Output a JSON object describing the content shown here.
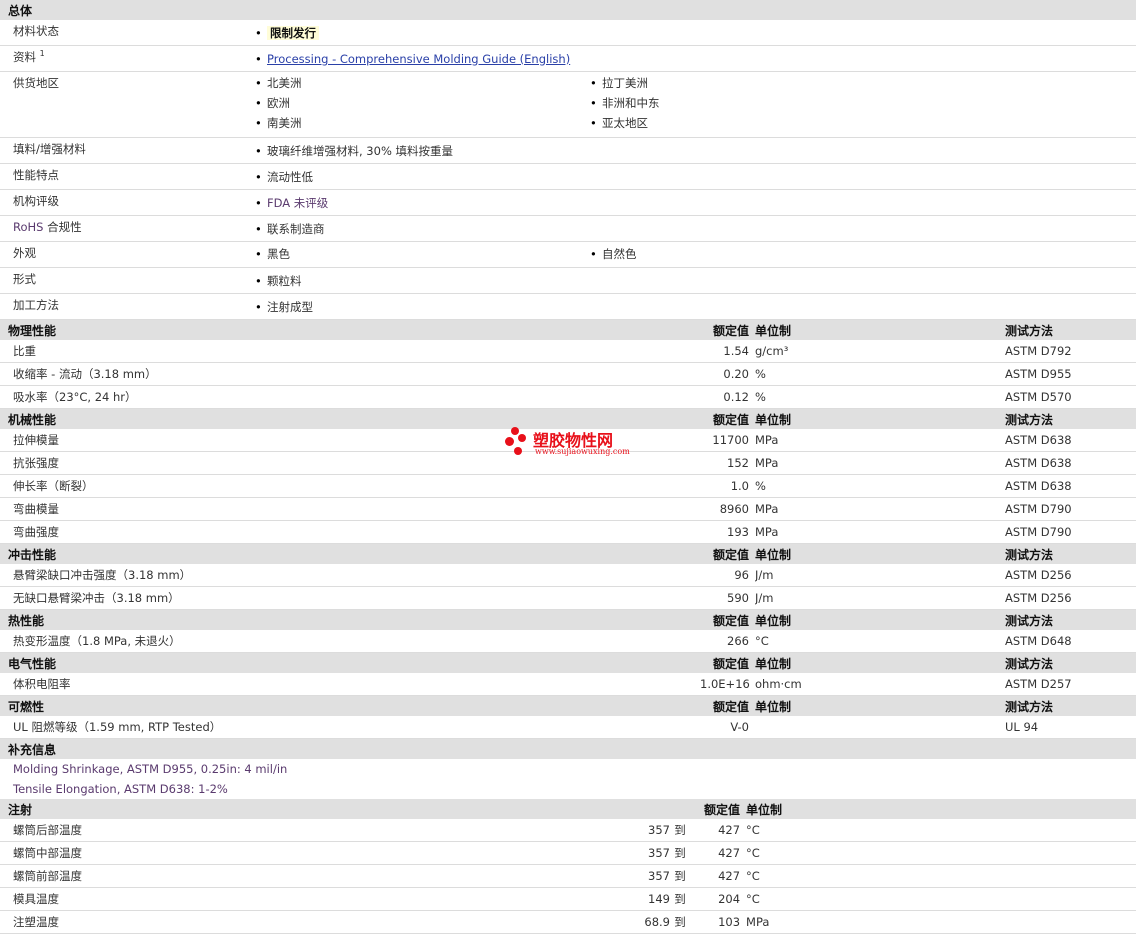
{
  "general": {
    "header": "总体",
    "material_status": {
      "label": "材料状态",
      "value": "限制发行"
    },
    "literature": {
      "label": "资料",
      "sup": "1",
      "link": "Processing - Comprehensive Molding Guide (English)"
    },
    "availability": {
      "label": "供货地区",
      "items": [
        "北美洲",
        "拉丁美洲",
        "欧洲",
        "非洲和中东",
        "南美洲",
        "亚太地区"
      ]
    },
    "filler": {
      "label": "填料/增强材料",
      "value": "玻璃纤维增强材料, 30% 填料按重量"
    },
    "features": {
      "label": "性能特点",
      "value": "流动性低"
    },
    "agency": {
      "label": "机构评级",
      "value": "FDA 未评级"
    },
    "rohs": {
      "label_rohs": "RoHS",
      "label_rest": " 合规性",
      "value": "联系制造商"
    },
    "appearance": {
      "label": "外观",
      "items": [
        "黑色",
        "自然色"
      ]
    },
    "form": {
      "label": "形式",
      "value": "颗粒料"
    },
    "processing": {
      "label": "加工方法",
      "value": "注射成型"
    }
  },
  "col_headers": {
    "value": "额定值",
    "unit": "单位制",
    "method": "测试方法"
  },
  "physical": {
    "header": "物理性能",
    "rows": [
      {
        "prop": "比重",
        "value": "1.54",
        "unit": "g/cm³",
        "method": "ASTM D792"
      },
      {
        "prop": "收缩率 - 流动（3.18 mm）",
        "value": "0.20",
        "unit": "%",
        "method": "ASTM D955"
      },
      {
        "prop": "吸水率（23°C, 24 hr）",
        "value": "0.12",
        "unit": "%",
        "method": "ASTM D570"
      }
    ]
  },
  "mechanical": {
    "header": "机械性能",
    "rows": [
      {
        "prop": "拉伸模量",
        "value": "11700",
        "unit": "MPa",
        "method": "ASTM D638"
      },
      {
        "prop": "抗张强度",
        "value": "152",
        "unit": "MPa",
        "method": "ASTM D638"
      },
      {
        "prop": "伸长率（断裂）",
        "value": "1.0",
        "unit": "%",
        "method": "ASTM D638"
      },
      {
        "prop": "弯曲模量",
        "value": "8960",
        "unit": "MPa",
        "method": "ASTM D790"
      },
      {
        "prop": "弯曲强度",
        "value": "193",
        "unit": "MPa",
        "method": "ASTM D790"
      }
    ]
  },
  "impact": {
    "header": "冲击性能",
    "rows": [
      {
        "prop": "悬臂梁缺口冲击强度（3.18 mm）",
        "value": "96",
        "unit": "J/m",
        "method": "ASTM D256"
      },
      {
        "prop": "无缺口悬臂梁冲击（3.18 mm）",
        "value": "590",
        "unit": "J/m",
        "method": "ASTM D256"
      }
    ]
  },
  "thermal": {
    "header": "热性能",
    "rows": [
      {
        "prop": "热变形温度（1.8 MPa, 未退火）",
        "value": "266",
        "unit": "°C",
        "method": "ASTM D648"
      }
    ]
  },
  "electrical": {
    "header": "电气性能",
    "rows": [
      {
        "prop": "体积电阻率",
        "value": "1.0E+16",
        "unit": "ohm·cm",
        "method": "ASTM D257"
      }
    ]
  },
  "flammability": {
    "header": "可燃性",
    "rows": [
      {
        "prop": "UL 阻燃等级（1.59 mm, RTP Tested）",
        "value": "V-0",
        "unit": "",
        "method": "UL 94"
      }
    ]
  },
  "supplemental": {
    "header": "补充信息",
    "lines": [
      "Molding Shrinkage, ASTM D955, 0.25in: 4 mil/in",
      "Tensile Elongation, ASTM D638: 1-2%"
    ]
  },
  "injection": {
    "header": "注射",
    "to": "到",
    "rows": [
      {
        "prop": "螺筒后部温度",
        "from": "357",
        "until": "427",
        "unit": "°C"
      },
      {
        "prop": "螺筒中部温度",
        "from": "357",
        "until": "427",
        "unit": "°C"
      },
      {
        "prop": "螺筒前部温度",
        "from": "357",
        "until": "427",
        "unit": "°C"
      },
      {
        "prop": "模具温度",
        "from": "149",
        "until": "204",
        "unit": "°C"
      },
      {
        "prop": "注塑温度",
        "from": "68.9",
        "until": "103",
        "unit": "MPa"
      }
    ]
  },
  "watermark": {
    "title": "塑胶物性网",
    "url": "www.sujiaowuxing.com"
  }
}
